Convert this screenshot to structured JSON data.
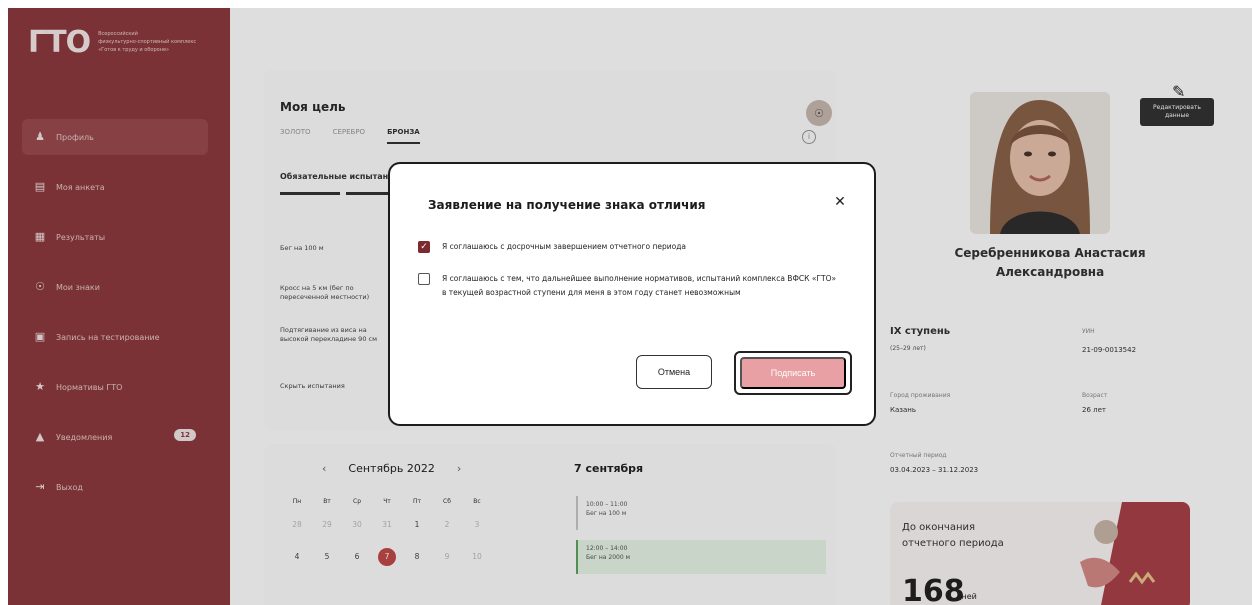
{
  "brand": {
    "logo": "ГТО",
    "tagline_lines": [
      "Всероссийский",
      "физкультурно-спортивный комплекс",
      "«Готов к труду и обороне»"
    ]
  },
  "sidebar": {
    "items": [
      {
        "label": "Профиль",
        "icon": "user-icon"
      },
      {
        "label": "Моя анкета",
        "icon": "document-icon"
      },
      {
        "label": "Результаты",
        "icon": "results-icon"
      },
      {
        "label": "Мои знаки",
        "icon": "medal-icon"
      },
      {
        "label": "Запись на тестирование",
        "icon": "calendar-icon"
      },
      {
        "label": "Нормативы ГТО",
        "icon": "trophy-icon"
      },
      {
        "label": "Уведомления",
        "icon": "bell-icon",
        "badge": "12"
      },
      {
        "label": "Выход",
        "icon": "logout-icon"
      }
    ]
  },
  "goal": {
    "title": "Моя цель",
    "tabs": [
      "ЗОЛОТО",
      "СЕРЕБРО",
      "БРОНЗА"
    ],
    "active_tab": "БРОНЗА",
    "required_title": "Обязательные испытания",
    "rows": [
      "Бег на 100 м",
      "Кросс на 5 км (бег по пересеченной местности)",
      "Подтягивание из виса на высокой перекладине 90 см",
      "Скрыть испытания"
    ]
  },
  "calendar": {
    "month_label": "Сентябрь 2022",
    "day_title": "7 сентября",
    "weekdays": [
      "Пн",
      "Вт",
      "Ср",
      "Чт",
      "Пт",
      "Сб",
      "Вс"
    ],
    "week1": [
      "28",
      "29",
      "30",
      "31",
      "1",
      "2",
      "3"
    ],
    "week2": [
      "4",
      "5",
      "6",
      "7",
      "8",
      "9",
      "10"
    ],
    "events": [
      {
        "time": "10:00 – 11:00",
        "title": "Бег на 100 м"
      },
      {
        "time": "12:00 – 14:00",
        "title": "Бег на 2000 м"
      }
    ]
  },
  "profile": {
    "edit_tooltip": "Редактировать данные",
    "name_line1": "Серебренникова Анастасия",
    "name_line2": "Александровна",
    "stage": "IX ступень",
    "stage_sub": "(25–29 лет)",
    "uin_label": "УИН",
    "uin": "21-09-0013542",
    "city_label": "Город проживания",
    "city": "Казань",
    "age_label": "Возраст",
    "age": "26 лет",
    "period_label": "Отчетный период",
    "period": "03.04.2023 – 31.12.2023",
    "deadline_text_line1": "До окончания",
    "deadline_text_line2": "отчетного периода",
    "deadline_days": "168",
    "deadline_unit": "дней"
  },
  "modal": {
    "title": "Заявление на получение знака отличия",
    "checkbox1": "Я соглашаюсь с досрочным завершением отчетного периода",
    "checkbox1_checked": true,
    "checkbox2": "Я соглашаюсь с тем, что дальнейшее выполнение нормативов, испытаний комплекса ВФСК «ГТО» в текущей возрастной ступени для меня в этом году станет невозможным",
    "checkbox2_checked": false,
    "cancel_label": "Отмена",
    "sign_label": "Подписать"
  },
  "colors": {
    "sidebar": "#8e3a3e",
    "accent": "#7c2a2e",
    "sign_button": "#e8a0a4",
    "selected_day": "#c14a48"
  }
}
